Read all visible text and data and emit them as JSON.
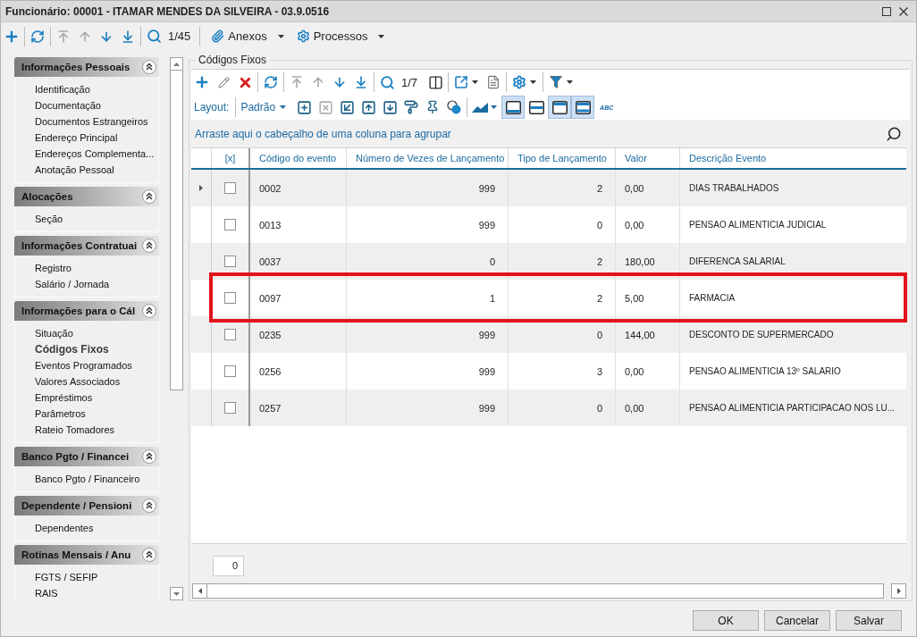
{
  "window": {
    "title": "Funcionário: 00001 - ITAMAR MENDES DA SILVEIRA - 03.9.0516"
  },
  "toolbar": {
    "nav": [
      {
        "kind": "first",
        "disabled": true
      },
      {
        "kind": "previous",
        "disabled": true
      },
      {
        "kind": "next",
        "disabled": false
      },
      {
        "kind": "last",
        "disabled": false
      }
    ],
    "record_counter": "1/45",
    "menus": [
      {
        "kind": "attachments",
        "label": "Anexos"
      },
      {
        "kind": "processes",
        "label": "Processos"
      }
    ]
  },
  "sidebar": {
    "groups": [
      {
        "title": "Informações Pessoais",
        "expanded": true,
        "items": [
          {
            "label": "Identificação",
            "selected": false
          },
          {
            "label": "Documentação",
            "selected": false
          },
          {
            "label": "Documentos Estrangeiros",
            "selected": false
          },
          {
            "label": "Endereço Principal",
            "selected": false
          },
          {
            "label": "Endereços Complementa...",
            "selected": false
          },
          {
            "label": "Anotação Pessoal",
            "selected": false
          }
        ]
      },
      {
        "title": "Alocações",
        "expanded": true,
        "items": [
          {
            "label": "Seção",
            "selected": false
          }
        ]
      },
      {
        "title": "Informações Contratuai",
        "expanded": true,
        "items": [
          {
            "label": "Registro",
            "selected": false
          },
          {
            "label": "Salário / Jornada",
            "selected": false
          }
        ]
      },
      {
        "title": "Informações para o Cál",
        "expanded": true,
        "items": [
          {
            "label": "Situação",
            "selected": false
          },
          {
            "label": "Códigos Fixos",
            "selected": true
          },
          {
            "label": "Eventos Programados",
            "selected": false
          },
          {
            "label": "Valores Associados",
            "selected": false
          },
          {
            "label": "Empréstimos",
            "selected": false
          },
          {
            "label": "Parâmetros",
            "selected": false
          },
          {
            "label": "Rateio Tomadores",
            "selected": false
          }
        ]
      },
      {
        "title": "Banco Pgto / Financei",
        "expanded": true,
        "items": [
          {
            "label": "Banco Pgto / Financeiro",
            "selected": false
          }
        ]
      },
      {
        "title": "Dependente / Pensioni",
        "expanded": true,
        "items": [
          {
            "label": "Dependentes",
            "selected": false
          }
        ]
      },
      {
        "title": "Rotinas Mensais / Anu",
        "expanded": true,
        "items": [
          {
            "label": "FGTS / SEFIP",
            "selected": false
          },
          {
            "label": "RAIS",
            "selected": false
          }
        ]
      }
    ]
  },
  "panel": {
    "title": "Códigos Fixos",
    "toolbar": {
      "nav": [
        {
          "kind": "first",
          "disabled": true
        },
        {
          "kind": "previous",
          "disabled": true
        },
        {
          "kind": "next",
          "disabled": false
        },
        {
          "kind": "last",
          "disabled": false
        }
      ],
      "record_counter": "1/7"
    },
    "layout": {
      "label": "Layout:",
      "value": "Padrão",
      "views": [
        {
          "kind": "bottom",
          "selected": true
        },
        {
          "kind": "middle",
          "selected": false
        },
        {
          "kind": "top",
          "selected": true
        },
        {
          "kind": "double",
          "selected": true
        }
      ],
      "abc_button": "ABC"
    },
    "group_hint": "Arraste aqui o cabeçalho de uma coluna para agrupar",
    "table": {
      "columns": [
        "[x]",
        "Código do evento",
        "Número de Vezes de Lançamento",
        "Tipo de Lançamento",
        "Valor",
        "Descrição Evento"
      ],
      "rows": [
        {
          "current": true,
          "checked": false,
          "highlighted": false,
          "code": "0002",
          "times": "999",
          "type": "2",
          "value": "0,00",
          "description": "DIAS TRABALHADOS"
        },
        {
          "current": false,
          "checked": false,
          "highlighted": false,
          "code": "0013",
          "times": "999",
          "type": "0",
          "value": "0,00",
          "description": "PENSAO ALIMENTICIA JUDICIAL"
        },
        {
          "current": false,
          "checked": false,
          "highlighted": false,
          "code": "0037",
          "times": "0",
          "type": "2",
          "value": "180,00",
          "description": "DIFERENCA SALARIAL"
        },
        {
          "current": false,
          "checked": false,
          "highlighted": true,
          "code": "0097",
          "times": "1",
          "type": "2",
          "value": "5,00",
          "description": "FARMACIA"
        },
        {
          "current": false,
          "checked": false,
          "highlighted": false,
          "code": "0235",
          "times": "999",
          "type": "0",
          "value": "144,00",
          "description": "DESCONTO DE SUPERMERCADO"
        },
        {
          "current": false,
          "checked": false,
          "highlighted": false,
          "code": "0256",
          "times": "999",
          "type": "3",
          "value": "0,00",
          "description": "PENSAO ALIMENTICIA 13º SALARIO"
        },
        {
          "current": false,
          "checked": false,
          "highlighted": false,
          "code": "0257",
          "times": "999",
          "type": "0",
          "value": "0,00",
          "description": "PENSAO ALIMENTICIA PARTICIPACAO NOS LU..."
        }
      ]
    },
    "summary": "0"
  },
  "buttons": [
    "OK",
    "Cancelar",
    "Salvar"
  ]
}
